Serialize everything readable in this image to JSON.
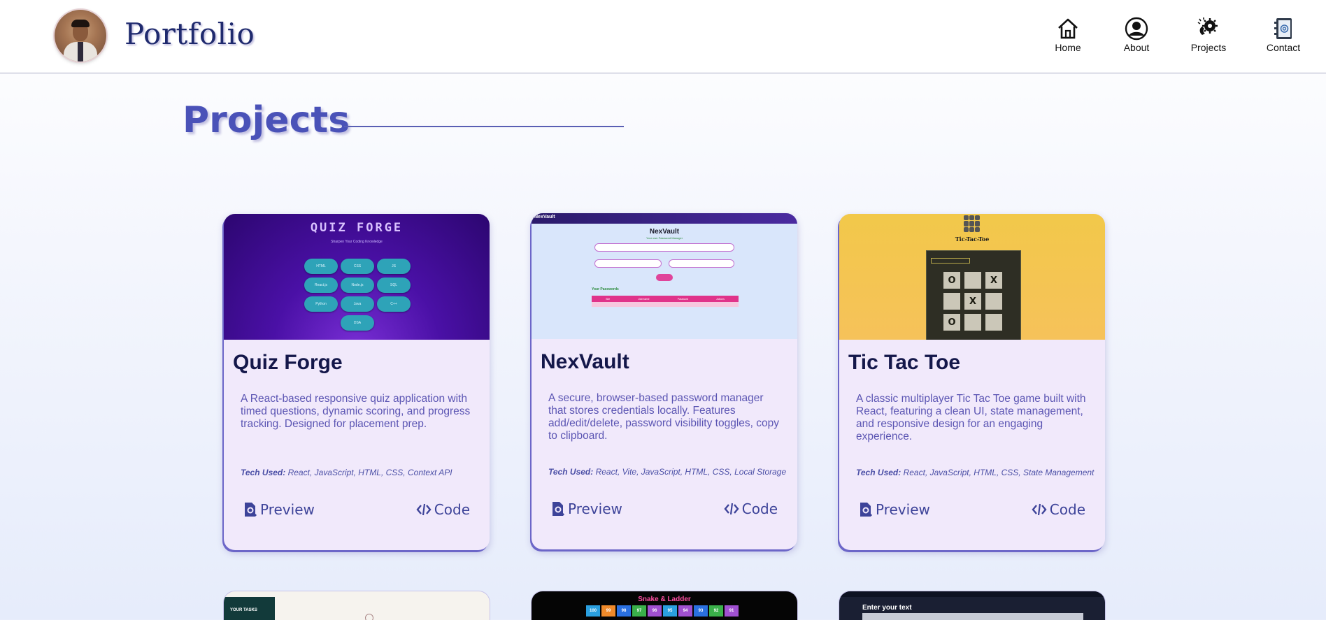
{
  "header": {
    "brand": "Portfolio",
    "nav": [
      {
        "label": "Home",
        "icon": "home-icon"
      },
      {
        "label": "About",
        "icon": "user-icon"
      },
      {
        "label": "Projects",
        "icon": "projects-icon"
      },
      {
        "label": "Contact",
        "icon": "contact-book-icon"
      }
    ]
  },
  "section": {
    "title": "Projects"
  },
  "projects": [
    {
      "title": "Quiz Forge",
      "description": "A React-based responsive quiz application with timed questions, dynamic scoring, and progress tracking. Designed for placement prep.",
      "tech_label": "Tech Used:",
      "tech": "React, JavaScript, HTML, CSS, Context API",
      "preview_label": "Preview",
      "code_label": "Code",
      "thumb": {
        "heading": "QUIZ FORGE",
        "subheading": "Sharpen Your Coding Knowledge",
        "topics": [
          "HTML",
          "CSS",
          "JS",
          "React.js",
          "Node.js",
          "SQL",
          "Python",
          "Java",
          "C++",
          "DSA"
        ]
      }
    },
    {
      "title": "NexVault",
      "description": "A secure, browser-based password manager that stores credentials locally. Features add/edit/delete, password visibility toggles, copy to clipboard.",
      "tech_label": "Tech Used:",
      "tech": "React, Vite, JavaScript, HTML, CSS, Local Storage",
      "preview_label": "Preview",
      "code_label": "Code",
      "thumb": {
        "brand": "NexVault",
        "tagline": "Your own Password Manager",
        "section": "Your Passwords",
        "columns": [
          "Site",
          "Username",
          "Password",
          "Actions"
        ]
      }
    },
    {
      "title": "Tic Tac Toe",
      "description": "A classic multiplayer Tic Tac Toe game built with React, featuring a clean UI, state management, and responsive design for an engaging experience.",
      "tech_label": "Tech Used:",
      "tech": "React, JavaScript, HTML, CSS, State Management",
      "preview_label": "Preview",
      "code_label": "Code",
      "thumb": {
        "heading": "Tic-Tac-Toe",
        "board": [
          "O",
          "",
          "X",
          "",
          "X",
          "",
          "O",
          "",
          ""
        ]
      }
    }
  ],
  "partial_cards": [
    {
      "caption": "YOUR TASKS"
    },
    {
      "caption": "Snake & Ladder",
      "numbers": [
        "100",
        "99",
        "98",
        "97",
        "96",
        "95",
        "94",
        "93",
        "92",
        "91"
      ]
    },
    {
      "caption": "Enter your text"
    }
  ],
  "colors": {
    "accent": "#4a52b8",
    "card_bg": "#f1e9fb",
    "title_dark": "#14174a",
    "desc_text": "#5b55b3"
  }
}
